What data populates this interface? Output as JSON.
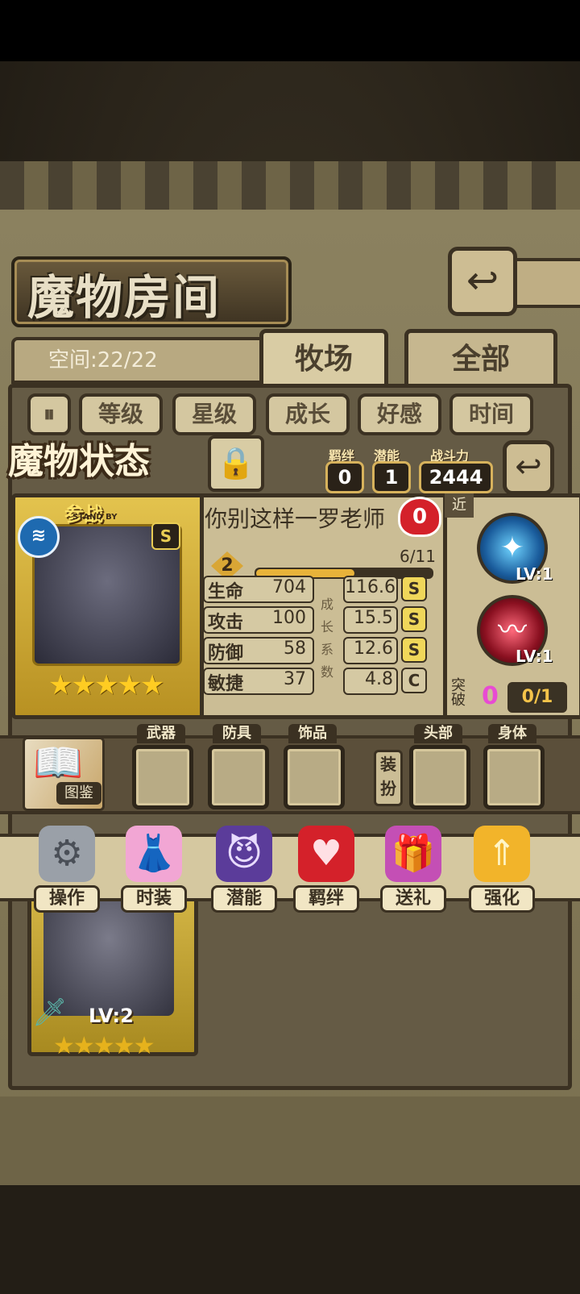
{
  "header": {
    "title": "魔物房间",
    "back_icon": "return-arrow-icon",
    "space_text": "空间:22/22"
  },
  "tabs": [
    {
      "label": "牧场",
      "active": true
    },
    {
      "label": "全部",
      "active": false
    }
  ],
  "sort_buttons": [
    "等级",
    "星级",
    "成长",
    "好感",
    "时间"
  ],
  "sort_toggle_icon": "pause-sort-icon",
  "status": {
    "label": "魔物状态",
    "lock_icon": "padlock-icon",
    "bond_label": "羁绊",
    "bond_value": "0",
    "potential_label": "潜能",
    "potential_value": "1",
    "power_label": "战斗力",
    "power_value": "2444",
    "return_icon": "return-arrow-icon"
  },
  "card": {
    "standby_text": "参战",
    "standby_sub": "STAND BY",
    "element_icon": "water-element-icon",
    "rank": "S",
    "stars": "★★★★★",
    "star_count": 5
  },
  "info": {
    "name": "你别这样一罗老师",
    "affection": "0",
    "level": "2",
    "exp_text": "6/11",
    "exp_progress": 0.545,
    "coef_label": "成长系数",
    "stats": [
      {
        "name": "生命",
        "value": "704",
        "growth": "116.6",
        "grade": "S"
      },
      {
        "name": "攻击",
        "value": "100",
        "growth": "15.5",
        "grade": "S"
      },
      {
        "name": "防御",
        "value": "58",
        "growth": "12.6",
        "grade": "S"
      },
      {
        "name": "敏捷",
        "value": "37",
        "growth": "4.8",
        "grade": "C"
      }
    ]
  },
  "skills": {
    "range_tag": "近",
    "items": [
      {
        "icon": "blue-star-skill-icon",
        "level": "LV:1",
        "color": "#1a5c9c"
      },
      {
        "icon": "red-pulse-skill-icon",
        "level": "LV:1",
        "color": "#8a1020"
      }
    ],
    "break_label": "突破",
    "break_value": "0",
    "break_progress": "0/1"
  },
  "equipment": {
    "book_label": "图鉴",
    "dress_label": "装扮",
    "slots": [
      "武器",
      "防具",
      "饰品",
      "头部",
      "身体"
    ]
  },
  "actions": [
    {
      "label": "操作",
      "icon": "gear-icon",
      "color": "#9aa0a8"
    },
    {
      "label": "时装",
      "icon": "outfit-icon",
      "color": "#f2a6d4"
    },
    {
      "label": "潜能",
      "icon": "shadow-demon-icon",
      "color": "#5b3c9a"
    },
    {
      "label": "羁绊",
      "icon": "hearts-icon",
      "color": "#d4212a"
    },
    {
      "label": "送礼",
      "icon": "gift-box-icon",
      "color": "#c44fb5"
    },
    {
      "label": "强化",
      "icon": "double-up-arrow-icon",
      "color": "#f2b42a"
    }
  ],
  "second_card": {
    "level": "LV:2",
    "stars": "★★★★★"
  }
}
